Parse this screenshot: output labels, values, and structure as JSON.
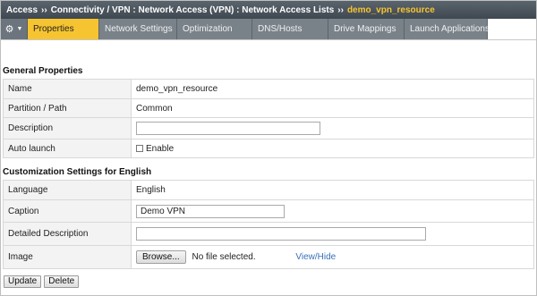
{
  "breadcrumb": {
    "items": [
      "Access",
      "Connectivity / VPN : Network Access (VPN) : Network Access Lists"
    ],
    "separator": "››",
    "current": "demo_vpn_resource"
  },
  "tabs": {
    "gear_icon": "gear-icon",
    "items": [
      {
        "label": "Properties",
        "active": true
      },
      {
        "label": "Network Settings",
        "active": false
      },
      {
        "label": "Optimization",
        "active": false
      },
      {
        "label": "DNS/Hosts",
        "active": false
      },
      {
        "label": "Drive Mappings",
        "active": false
      },
      {
        "label": "Launch Applications",
        "active": false
      }
    ]
  },
  "general": {
    "title": "General Properties",
    "name_label": "Name",
    "name_value": "demo_vpn_resource",
    "partition_label": "Partition / Path",
    "partition_value": "Common",
    "description_label": "Description",
    "description_value": "",
    "autolaunch_label": "Auto launch",
    "autolaunch_checkbox_label": "Enable",
    "autolaunch_checked": false
  },
  "customization": {
    "title": "Customization Settings for English",
    "language_label": "Language",
    "language_value": "English",
    "caption_label": "Caption",
    "caption_value": "Demo VPN",
    "detailed_label": "Detailed Description",
    "detailed_value": "",
    "image_label": "Image",
    "browse_label": "Browse...",
    "file_status": "No file selected.",
    "view_hide": "View/Hide"
  },
  "actions": {
    "update": "Update",
    "delete": "Delete"
  },
  "colors": {
    "accent_active_tab": "#f7c431",
    "breadcrumb_current": "#f7c431",
    "link": "#3a6fb8"
  }
}
